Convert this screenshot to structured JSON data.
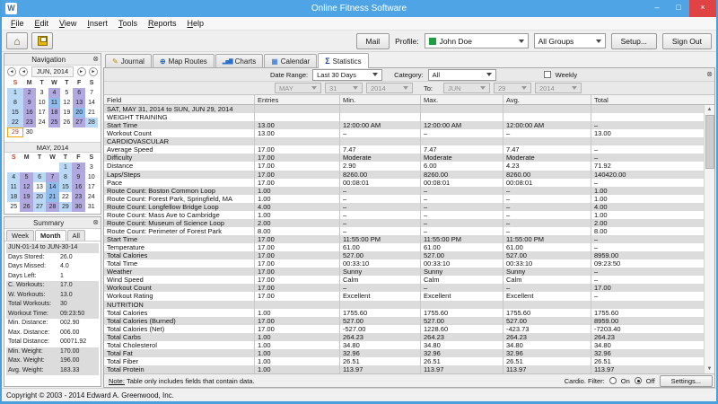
{
  "window": {
    "title": "Online Fitness Software",
    "icon_letter": "W",
    "minimize": "–",
    "maximize": "□",
    "close": "×"
  },
  "menu": [
    "File",
    "Edit",
    "View",
    "Insert",
    "Tools",
    "Reports",
    "Help"
  ],
  "toolbar": {
    "mail_label": "Mail",
    "profile_label": "Profile:",
    "profile_value": "John Doe",
    "profile_swatch_color": "#1e9e3e",
    "groups_value": "All Groups",
    "setup_label": "Setup...",
    "signout_label": "Sign Out"
  },
  "navigation": {
    "title": "Navigation",
    "month_title": "JUN, 2014",
    "may_title": "MAY, 2014",
    "day_headers": [
      "S",
      "M",
      "T",
      "W",
      "T",
      "F",
      "S"
    ],
    "june": {
      "offset": 0,
      "days": 30,
      "cardio": [
        1,
        8,
        15,
        22,
        28
      ],
      "weights": [
        2,
        4,
        6,
        9,
        13,
        16,
        18,
        23,
        25,
        27
      ],
      "both": [
        11,
        20
      ],
      "selected": [
        29
      ]
    },
    "may": {
      "offset": 4,
      "days": 31,
      "cardio": [
        1,
        4,
        6,
        8,
        11,
        15,
        18,
        20,
        27,
        29
      ],
      "weights": [
        2,
        5,
        7,
        9,
        12,
        16,
        19,
        23,
        26,
        28,
        30
      ],
      "both": [
        14,
        21
      ],
      "selected": []
    }
  },
  "summary": {
    "title": "Summary",
    "tabs": [
      "Week",
      "Month",
      "All"
    ],
    "active_tab": "Month",
    "rows": [
      {
        "label": "JUN-01-14 to JUN-30-14",
        "value": "",
        "shade": true
      },
      {
        "label": "Days Stored:",
        "value": "26.0",
        "shade": false
      },
      {
        "label": "Days Missed:",
        "value": "4.0",
        "shade": false
      },
      {
        "label": "Days Left:",
        "value": "1",
        "shade": false
      },
      {
        "label": "C. Workouts:",
        "value": "17.0",
        "shade": true
      },
      {
        "label": "W. Workouts:",
        "value": "13.0",
        "shade": true
      },
      {
        "label": "Total Workouts:",
        "value": "30",
        "shade": true
      },
      {
        "label": "Workout Time:",
        "value": "09:23:50",
        "shade": true
      },
      {
        "label": "Min. Distance:",
        "value": "002.90",
        "shade": false
      },
      {
        "label": "Max. Distance:",
        "value": "006.00",
        "shade": false
      },
      {
        "label": "Total Distance:",
        "value": "00071.92",
        "shade": false
      },
      {
        "label": "Min. Weight:",
        "value": "170.00",
        "shade": true
      },
      {
        "label": "Max. Weight:",
        "value": "196.00",
        "shade": true
      },
      {
        "label": "Avg. Weight:",
        "value": "183.33",
        "shade": true
      }
    ]
  },
  "tabs": [
    {
      "label": "Journal",
      "icon": "journal-icon",
      "active": false
    },
    {
      "label": "Map Routes",
      "icon": "map-routes-icon",
      "active": false
    },
    {
      "label": "Charts",
      "icon": "charts-icon",
      "active": false
    },
    {
      "label": "Calendar",
      "icon": "calendar-icon",
      "active": false
    },
    {
      "label": "Statistics",
      "icon": "sigma-icon",
      "active": true
    }
  ],
  "filters": {
    "date_range_label": "Date Range:",
    "date_range_value": "Last 30 Days",
    "category_label": "Category:",
    "category_value": "All",
    "weekly_label": "Weekly",
    "weekly_checked": false,
    "from": [
      "MAY",
      "31",
      "2014"
    ],
    "to_label": "To:",
    "to": [
      "JUN",
      "29",
      "2014"
    ]
  },
  "table": {
    "headers": [
      "Field",
      "Entries",
      "Min.",
      "Max.",
      "Avg.",
      "Total"
    ],
    "rows": [
      {
        "section": true,
        "label": "SAT, MAY 31, 2014 to SUN, JUN 29, 2014"
      },
      {
        "section": true,
        "label": "WEIGHT TRAINING"
      },
      {
        "cells": [
          "Start Time",
          "13.00",
          "12:00:00 AM",
          "12:00:00 AM",
          "12:00:00 AM",
          "–"
        ]
      },
      {
        "cells": [
          "Workout Count",
          "13.00",
          "–",
          "–",
          "–",
          "13.00"
        ]
      },
      {
        "section": true,
        "label": "CARDIOVASCULAR"
      },
      {
        "cells": [
          "Average Speed",
          "17.00",
          "7.47",
          "7.47",
          "7.47",
          "–"
        ]
      },
      {
        "cells": [
          "Difficulty",
          "17.00",
          "Moderate",
          "Moderate",
          "Moderate",
          "–"
        ]
      },
      {
        "cells": [
          "Distance",
          "17.00",
          "2.90",
          "6.00",
          "4.23",
          "71.92"
        ]
      },
      {
        "cells": [
          "Laps/Steps",
          "17.00",
          "8260.00",
          "8260.00",
          "8260.00",
          "140420.00"
        ]
      },
      {
        "cells": [
          "Pace",
          "17.00",
          "00:08:01",
          "00:08:01",
          "00:08:01",
          "–"
        ]
      },
      {
        "cells": [
          "Route Count: Boston Common Loop",
          "1.00",
          "–",
          "–",
          "–",
          "1.00"
        ]
      },
      {
        "cells": [
          "Route Count: Forest Park, Springfield, MA",
          "1.00",
          "–",
          "–",
          "–",
          "1.00"
        ]
      },
      {
        "cells": [
          "Route Count: Longfellow Bridge Loop",
          "4.00",
          "–",
          "–",
          "–",
          "4.00"
        ]
      },
      {
        "cells": [
          "Route Count: Mass Ave to Cambridge",
          "1.00",
          "–",
          "–",
          "–",
          "1.00"
        ]
      },
      {
        "cells": [
          "Route Count: Museum of Science Loop",
          "2.00",
          "–",
          "–",
          "–",
          "2.00"
        ]
      },
      {
        "cells": [
          "Route Count: Perimeter of Forest Park",
          "8.00",
          "–",
          "–",
          "–",
          "8.00"
        ]
      },
      {
        "cells": [
          "Start Time",
          "17.00",
          "11:55:00 PM",
          "11:55:00 PM",
          "11:55:00 PM",
          "–"
        ]
      },
      {
        "cells": [
          "Temperature",
          "17.00",
          "61.00",
          "61.00",
          "61.00",
          "–"
        ]
      },
      {
        "cells": [
          "Total Calories",
          "17.00",
          "527.00",
          "527.00",
          "527.00",
          "8959.00"
        ]
      },
      {
        "cells": [
          "Total Time",
          "17.00",
          "00:33:10",
          "00:33:10",
          "00:33:10",
          "09:23:50"
        ]
      },
      {
        "cells": [
          "Weather",
          "17.00",
          "Sunny",
          "Sunny",
          "Sunny",
          "–"
        ]
      },
      {
        "cells": [
          "Wind Speed",
          "17.00",
          "Calm",
          "Calm",
          "Calm",
          "–"
        ]
      },
      {
        "cells": [
          "Workout Count",
          "17.00",
          "–",
          "–",
          "–",
          "17.00"
        ]
      },
      {
        "cells": [
          "Workout Rating",
          "17.00",
          "Excellent",
          "Excellent",
          "Excellent",
          "–"
        ]
      },
      {
        "section": true,
        "label": "NUTRITION"
      },
      {
        "cells": [
          "Total Calories",
          "1.00",
          "1755.60",
          "1755.60",
          "1755.60",
          "1755.60"
        ]
      },
      {
        "cells": [
          "Total Calories (Burned)",
          "17.00",
          "527.00",
          "527.00",
          "527.00",
          "8959.00"
        ]
      },
      {
        "cells": [
          "Total Calories (Net)",
          "17.00",
          "-527.00",
          "1228.60",
          "-423.73",
          "-7203.40"
        ]
      },
      {
        "cells": [
          "Total Carbs",
          "1.00",
          "264.23",
          "264.23",
          "264.23",
          "264.23"
        ]
      },
      {
        "cells": [
          "Total Cholesterol",
          "1.00",
          "34.80",
          "34.80",
          "34.80",
          "34.80"
        ]
      },
      {
        "cells": [
          "Total Fat",
          "1.00",
          "32.96",
          "32.96",
          "32.96",
          "32.96"
        ]
      },
      {
        "cells": [
          "Total Fiber",
          "1.00",
          "26.51",
          "26.51",
          "26.51",
          "26.51"
        ]
      },
      {
        "cells": [
          "Total Protein",
          "1.00",
          "113.97",
          "113.97",
          "113.97",
          "113.97"
        ]
      }
    ]
  },
  "footer": {
    "note_prefix": "Note:",
    "note_text": "Table only includes fields that contain data.",
    "cardio_filter_label": "Cardio. Filter:",
    "radio_on": "On",
    "radio_off": "Off",
    "radio_selected": "Off",
    "settings_label": "Settings..."
  },
  "statusbar": {
    "text": "Copyright © 2003 - 2014 Edward A. Greenwood, Inc."
  },
  "icon_glyphs": {
    "home-icon": "⌂",
    "journal-icon": "✎",
    "map-routes-icon": "⊕",
    "charts-icon": "▂▅▇",
    "calendar-icon": "▦",
    "sigma-icon": "Σ",
    "panel-close-icon": "⊗",
    "prev-year-icon": "◄",
    "prev-month-icon": "◄",
    "next-month-icon": "►",
    "next-year-icon": "►",
    "scroll-up-icon": "▲",
    "scroll-down-icon": "▼"
  },
  "colors": {
    "titlebar": "#4ea4e4",
    "close_button": "#e04343",
    "row_shade": "#dcdcdc",
    "calendar_cardio": "#b9d8f4",
    "calendar_weights": "#b2a8e0",
    "calendar_both": "#8fbcec",
    "calendar_selected_border": "#f0a500",
    "profile_swatch": "#1e9e3e"
  }
}
